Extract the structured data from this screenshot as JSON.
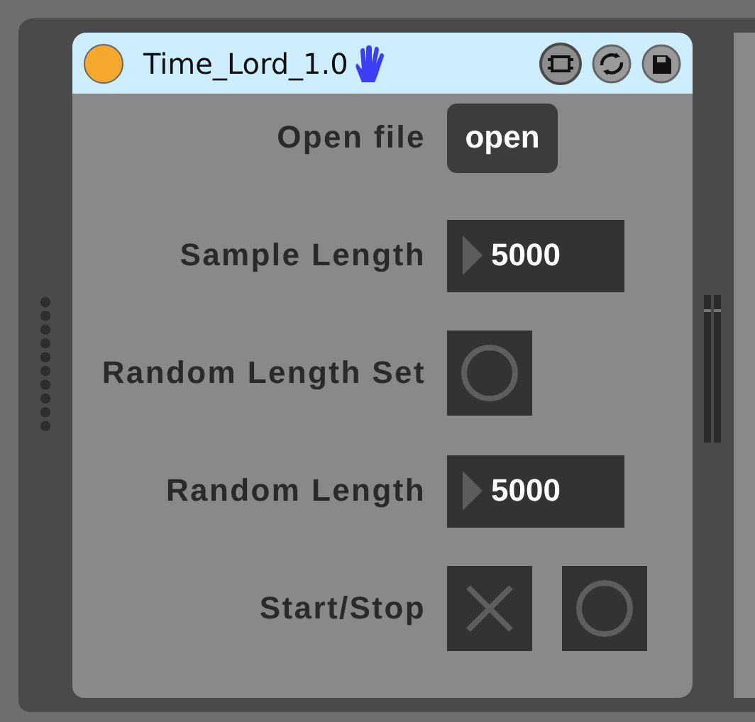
{
  "device": {
    "title": "Time_Lord_1.0"
  },
  "controls": [
    {
      "kind": "button",
      "label": "Open file",
      "text": "open"
    },
    {
      "kind": "number",
      "label": "Sample Length",
      "value": "5000"
    },
    {
      "kind": "toggle",
      "label": "Random Length Set",
      "on": false
    },
    {
      "kind": "number",
      "label": "Random Length",
      "value": "5000"
    },
    {
      "kind": "pair",
      "label": "Start/Stop",
      "on": false
    }
  ]
}
